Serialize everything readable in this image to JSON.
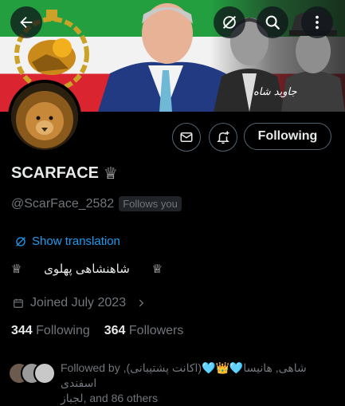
{
  "header": {
    "back_label": "back",
    "caption": "جاوید شاه"
  },
  "profile": {
    "name": "SCARFACE",
    "name_suffix": "♕",
    "handle": "@ScarFace_2582",
    "follows_you": "Follows you",
    "show_translation": "Show translation",
    "bio_left": "♕",
    "bio_text": "شاهنشاهی پهلوی",
    "bio_right": "♕",
    "joined": "Joined July 2023",
    "following_count": "344",
    "following_label": "Following",
    "followers_count": "364",
    "followers_label": "Followers",
    "followed_by_line1": "Followed by شاهی, هانیسا🩵👑🩵(اکانت پشتیبانی), اسفندی",
    "followed_by_line2": "لجباز, and 86 others"
  },
  "actions": {
    "following_button": "Following"
  },
  "colors": {
    "accent": "#1d9bf0",
    "muted": "#71767b",
    "text": "#e7e9ea",
    "border": "#536471"
  }
}
